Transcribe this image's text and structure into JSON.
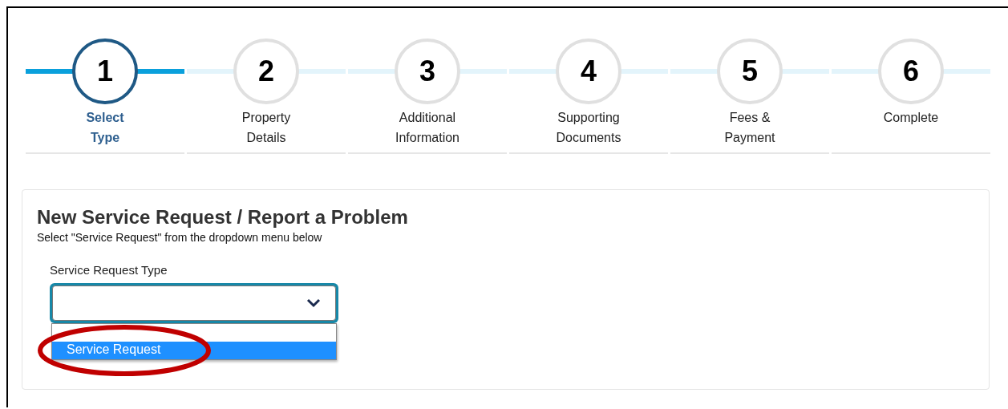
{
  "steps": [
    {
      "number": "1",
      "label": [
        "Select",
        "Type"
      ],
      "selected": true
    },
    {
      "number": "2",
      "label": [
        "Property",
        "Details"
      ],
      "selected": false
    },
    {
      "number": "3",
      "label": [
        "Additional",
        "Information"
      ],
      "selected": false
    },
    {
      "number": "4",
      "label": [
        "Supporting",
        "Documents"
      ],
      "selected": false
    },
    {
      "number": "5",
      "label": [
        "Fees &",
        "Payment"
      ],
      "selected": false
    },
    {
      "number": "6",
      "label": [
        "Complete"
      ],
      "selected": false
    }
  ],
  "form": {
    "title": "New Service Request / Report a Problem",
    "subtitle": "Select \"Service Request\" from the dropdown menu below",
    "field_label": "Service Request Type",
    "dropdown": {
      "expanded": true,
      "options": [
        {
          "label": "Service Request",
          "selected": true
        }
      ]
    }
  },
  "annotation": {
    "kind": "ellipse",
    "color": "#c00000"
  }
}
